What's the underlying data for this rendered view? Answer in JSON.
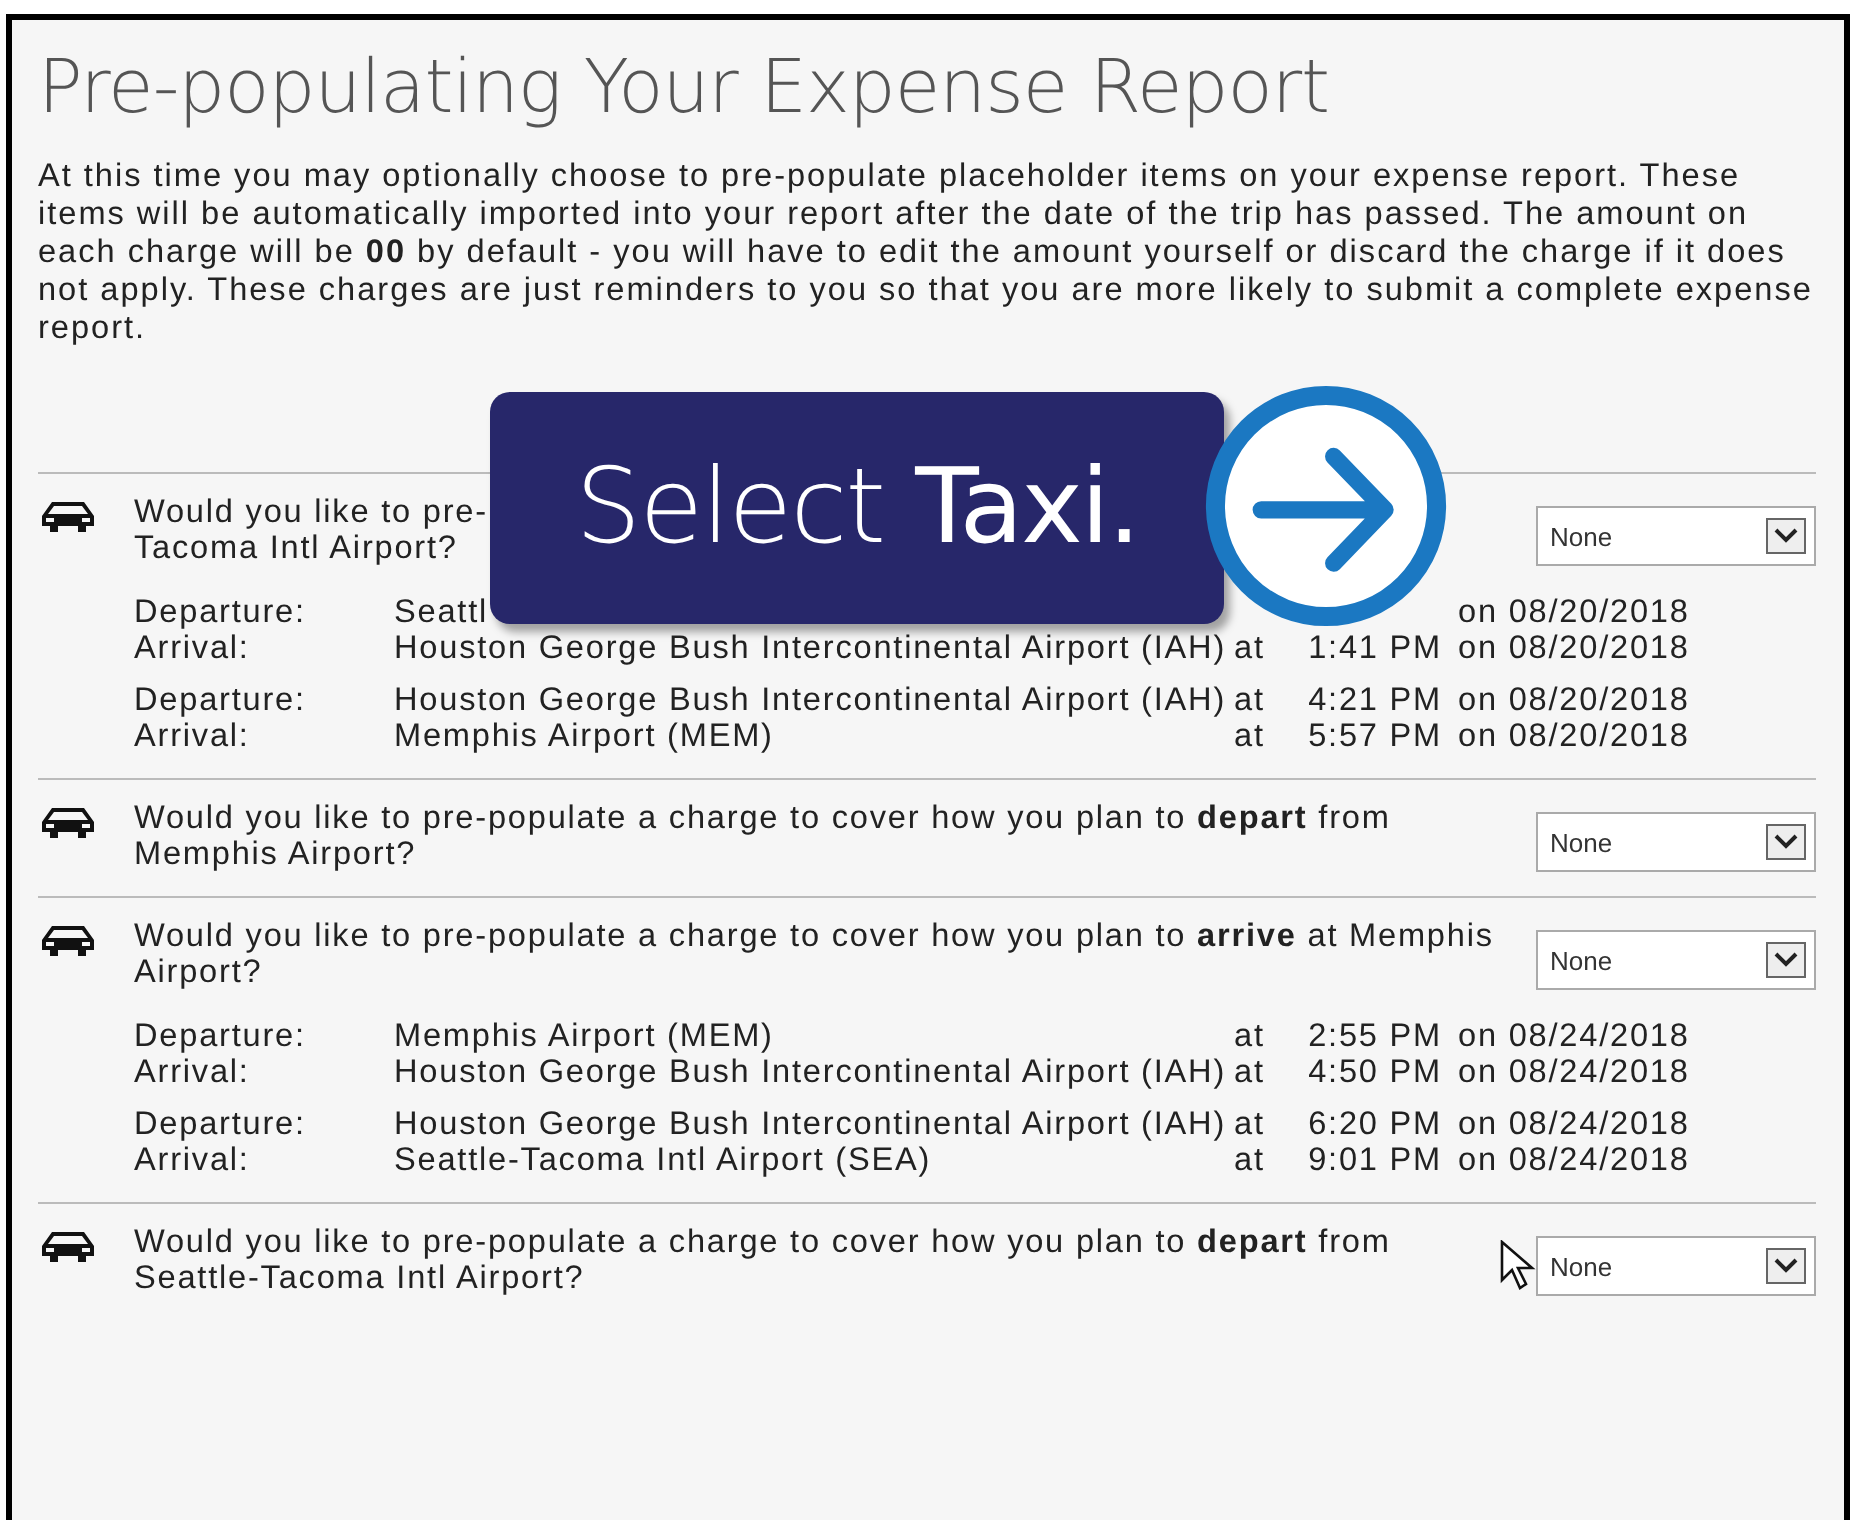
{
  "title": "Pre-populating Your Expense Report",
  "intro": "At this time you may optionally choose to pre-populate placeholder items on your expense report. These items will be automatically imported into your report after the date of the trip has passed. The amount on each charge will be **00** by default - you will have to edit the amount yourself or discard the charge if it does not apply. These charges are just reminders to you so that you are more likely to submit a complete expense report.",
  "sections": [
    {
      "kind": "covered",
      "question_parts": [
        "Would you like to pre-",
        "Tacoma Intl Airport?"
      ],
      "select": "None",
      "segments": [
        [
          {
            "label": "Departure:",
            "place": "Seattl",
            "date": "on 08/20/2018"
          },
          {
            "label": "Arrival:",
            "place": "Houston George Bush Intercontinental Airport (IAH)",
            "at": "at",
            "time": "1:41 PM",
            "date": "on 08/20/2018"
          }
        ],
        [
          {
            "label": "Departure:",
            "place": "Houston George Bush Intercontinental Airport (IAH)",
            "at": "at",
            "time": "4:21 PM",
            "date": "on 08/20/2018"
          },
          {
            "label": "Arrival:",
            "place": "Memphis Airport (MEM)",
            "at": "at",
            "time": "5:57 PM",
            "date": "on 08/20/2018"
          }
        ]
      ]
    },
    {
      "kind": "full",
      "question": "Would you like to pre-populate a charge to cover how you plan to **depart** from Memphis Airport?",
      "select": "None"
    },
    {
      "kind": "full",
      "question": "Would you like to pre-populate a charge to cover how you plan to **arrive** at Memphis Airport?",
      "select": "None",
      "segments": [
        [
          {
            "label": "Departure:",
            "place": "Memphis Airport (MEM)",
            "at": "at",
            "time": "2:55 PM",
            "date": "on 08/24/2018"
          },
          {
            "label": "Arrival:",
            "place": "Houston George Bush Intercontinental Airport (IAH)",
            "at": "at",
            "time": "4:50 PM",
            "date": "on 08/24/2018"
          }
        ],
        [
          {
            "label": "Departure:",
            "place": "Houston George Bush Intercontinental Airport (IAH)",
            "at": "at",
            "time": "6:20 PM",
            "date": "on 08/24/2018"
          },
          {
            "label": "Arrival:",
            "place": "Seattle-Tacoma Intl Airport (SEA)",
            "at": "at",
            "time": "9:01 PM",
            "date": "on 08/24/2018"
          }
        ]
      ]
    },
    {
      "kind": "full",
      "question": "Would you like to pre-populate a charge to cover how you plan to **depart** from Seattle-Tacoma Intl Airport?",
      "select": "None"
    }
  ],
  "callout": {
    "text": "Select **Taxi.**"
  }
}
